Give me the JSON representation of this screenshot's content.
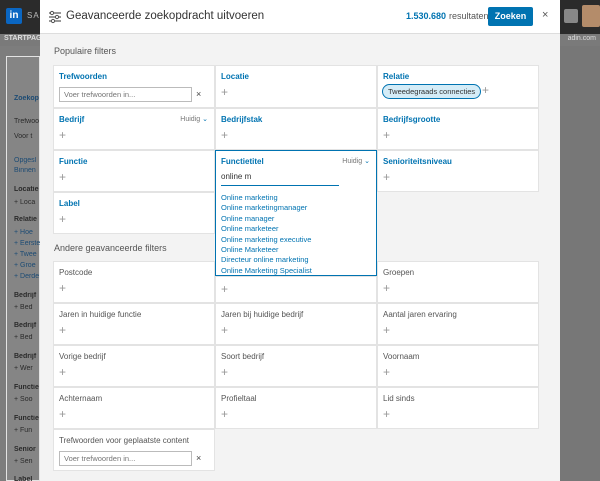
{
  "background": {
    "logo": "in",
    "brand": "SA",
    "subbar_left": "STARTPAG",
    "subbar_right": "adin.com",
    "side_items": [
      "Zoekop",
      "Trefwoo",
      "Voor t",
      "Opgesl",
      "Binnen",
      "Locatie",
      "+ Loca",
      "Relatie",
      "+ Hoe",
      "+ Eerste",
      "+ Twee",
      "+ Groe",
      "+ Derde",
      "Bedrijf",
      "+ Bed",
      "Bedrijf",
      "+ Bed",
      "Bedrijf",
      "+ Wer",
      "Functie",
      "+ Soo",
      "Functie",
      "+ Fun",
      "Senior",
      "+ Sen",
      "Label"
    ]
  },
  "header": {
    "title": "Geavanceerde zoekopdracht uitvoeren",
    "count": "1.530.680",
    "count_label": "resultaten",
    "search_button": "Zoeken",
    "close": "×"
  },
  "sections": {
    "popular": "Populaire filters",
    "other": "Andere geavanceerde filters"
  },
  "cards": {
    "trefwoorden": {
      "title": "Trefwoorden",
      "placeholder": "Voer trefwoorden in...",
      "clear": "×"
    },
    "locatie": {
      "title": "Locatie",
      "plus": "+"
    },
    "relatie": {
      "title": "Relatie",
      "tag": "Tweedegraads connecties",
      "plus": "+"
    },
    "bedrijf": {
      "title": "Bedrijf",
      "huidig": "Huidig",
      "plus": "+"
    },
    "bedrijfstak": {
      "title": "Bedrijfstak",
      "plus": "+"
    },
    "bedrijfsgrootte": {
      "title": "Bedrijfsgrootte",
      "plus": "+"
    },
    "functie": {
      "title": "Functie",
      "plus": "+"
    },
    "functietitel": {
      "title": "Functietitel",
      "huidig": "Huidig",
      "typed": "online m",
      "suggestions": [
        "Online marketing",
        "Online marketingmanager",
        "Online manager",
        "Online marketeer",
        "Online marketing executive",
        "Online Marketeer",
        "Directeur online marketing",
        "Online Marketing Specialist"
      ]
    },
    "senioriteit": {
      "title": "Senioriteitsniveau",
      "plus": "+"
    },
    "label": {
      "title": "Label",
      "plus": "+"
    },
    "postcode": {
      "title": "Postcode",
      "plus": "+"
    },
    "blank_mid": {
      "plus": "+"
    },
    "groepen": {
      "title": "Groepen",
      "plus": "+"
    },
    "jaren_functie": {
      "title": "Jaren in huidige functie",
      "plus": "+"
    },
    "jaren_bedrijf": {
      "title": "Jaren bij huidige bedrijf",
      "plus": "+"
    },
    "aantal_jaren": {
      "title": "Aantal jaren ervaring",
      "plus": "+"
    },
    "vorige_bedrijf": {
      "title": "Vorige bedrijf",
      "plus": "+"
    },
    "soort_bedrijf": {
      "title": "Soort bedrijf",
      "plus": "+"
    },
    "voornaam": {
      "title": "Voornaam",
      "plus": "+"
    },
    "achternaam": {
      "title": "Achternaam",
      "plus": "+"
    },
    "profieltaal": {
      "title": "Profieltaal",
      "plus": "+"
    },
    "lid_sinds": {
      "title": "Lid sinds",
      "plus": "+"
    },
    "trefwoorden_content": {
      "title": "Trefwoorden voor geplaatste content",
      "placeholder": "Voer trefwoorden in...",
      "clear": "×"
    }
  },
  "colors": {
    "accent": "#0073b1",
    "tag_bg": "#d4ecf7",
    "modal_bg": "#f3f3f3"
  }
}
